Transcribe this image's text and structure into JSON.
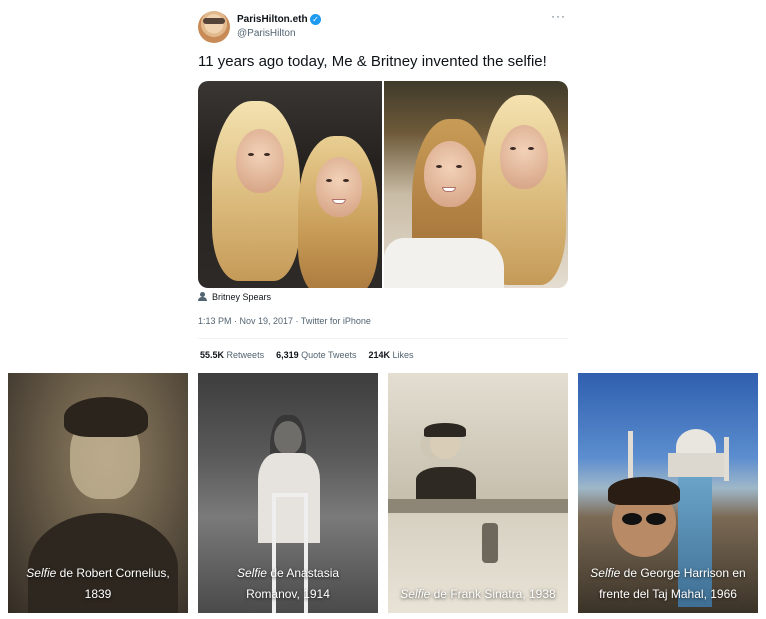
{
  "tweet": {
    "display_name": "ParisHilton.eth",
    "handle": "@ParisHilton",
    "more_icon": "more-horizontal-icon",
    "text": "11 years ago today, Me & Britney invented the selfie!",
    "tagged_user": "Britney Spears",
    "timestamp": "1:13 PM · Nov 19, 2017 · Twitter for iPhone",
    "stats": {
      "retweets_count": "55.5K",
      "retweets_label": "Retweets",
      "quotes_count": "6,319",
      "quotes_label": "Quote Tweets",
      "likes_count": "214K",
      "likes_label": "Likes"
    },
    "colors": {
      "verified": "#1d9bf0",
      "muted": "#536471"
    }
  },
  "gallery": [
    {
      "italic": "Selfie",
      "line1_rest": " de Robert Cornelius,",
      "line2": "1839"
    },
    {
      "italic": "Selfie",
      "line1_rest": " de Anastasia",
      "line2": "Romanov, 1914"
    },
    {
      "italic": "Selfie",
      "line1_rest": " de Frank Sinatra, 1938",
      "line2": ""
    },
    {
      "italic": "Selfie",
      "line1_rest": " de George Harrison en",
      "line2": "frente del Taj Mahal, 1966"
    }
  ]
}
